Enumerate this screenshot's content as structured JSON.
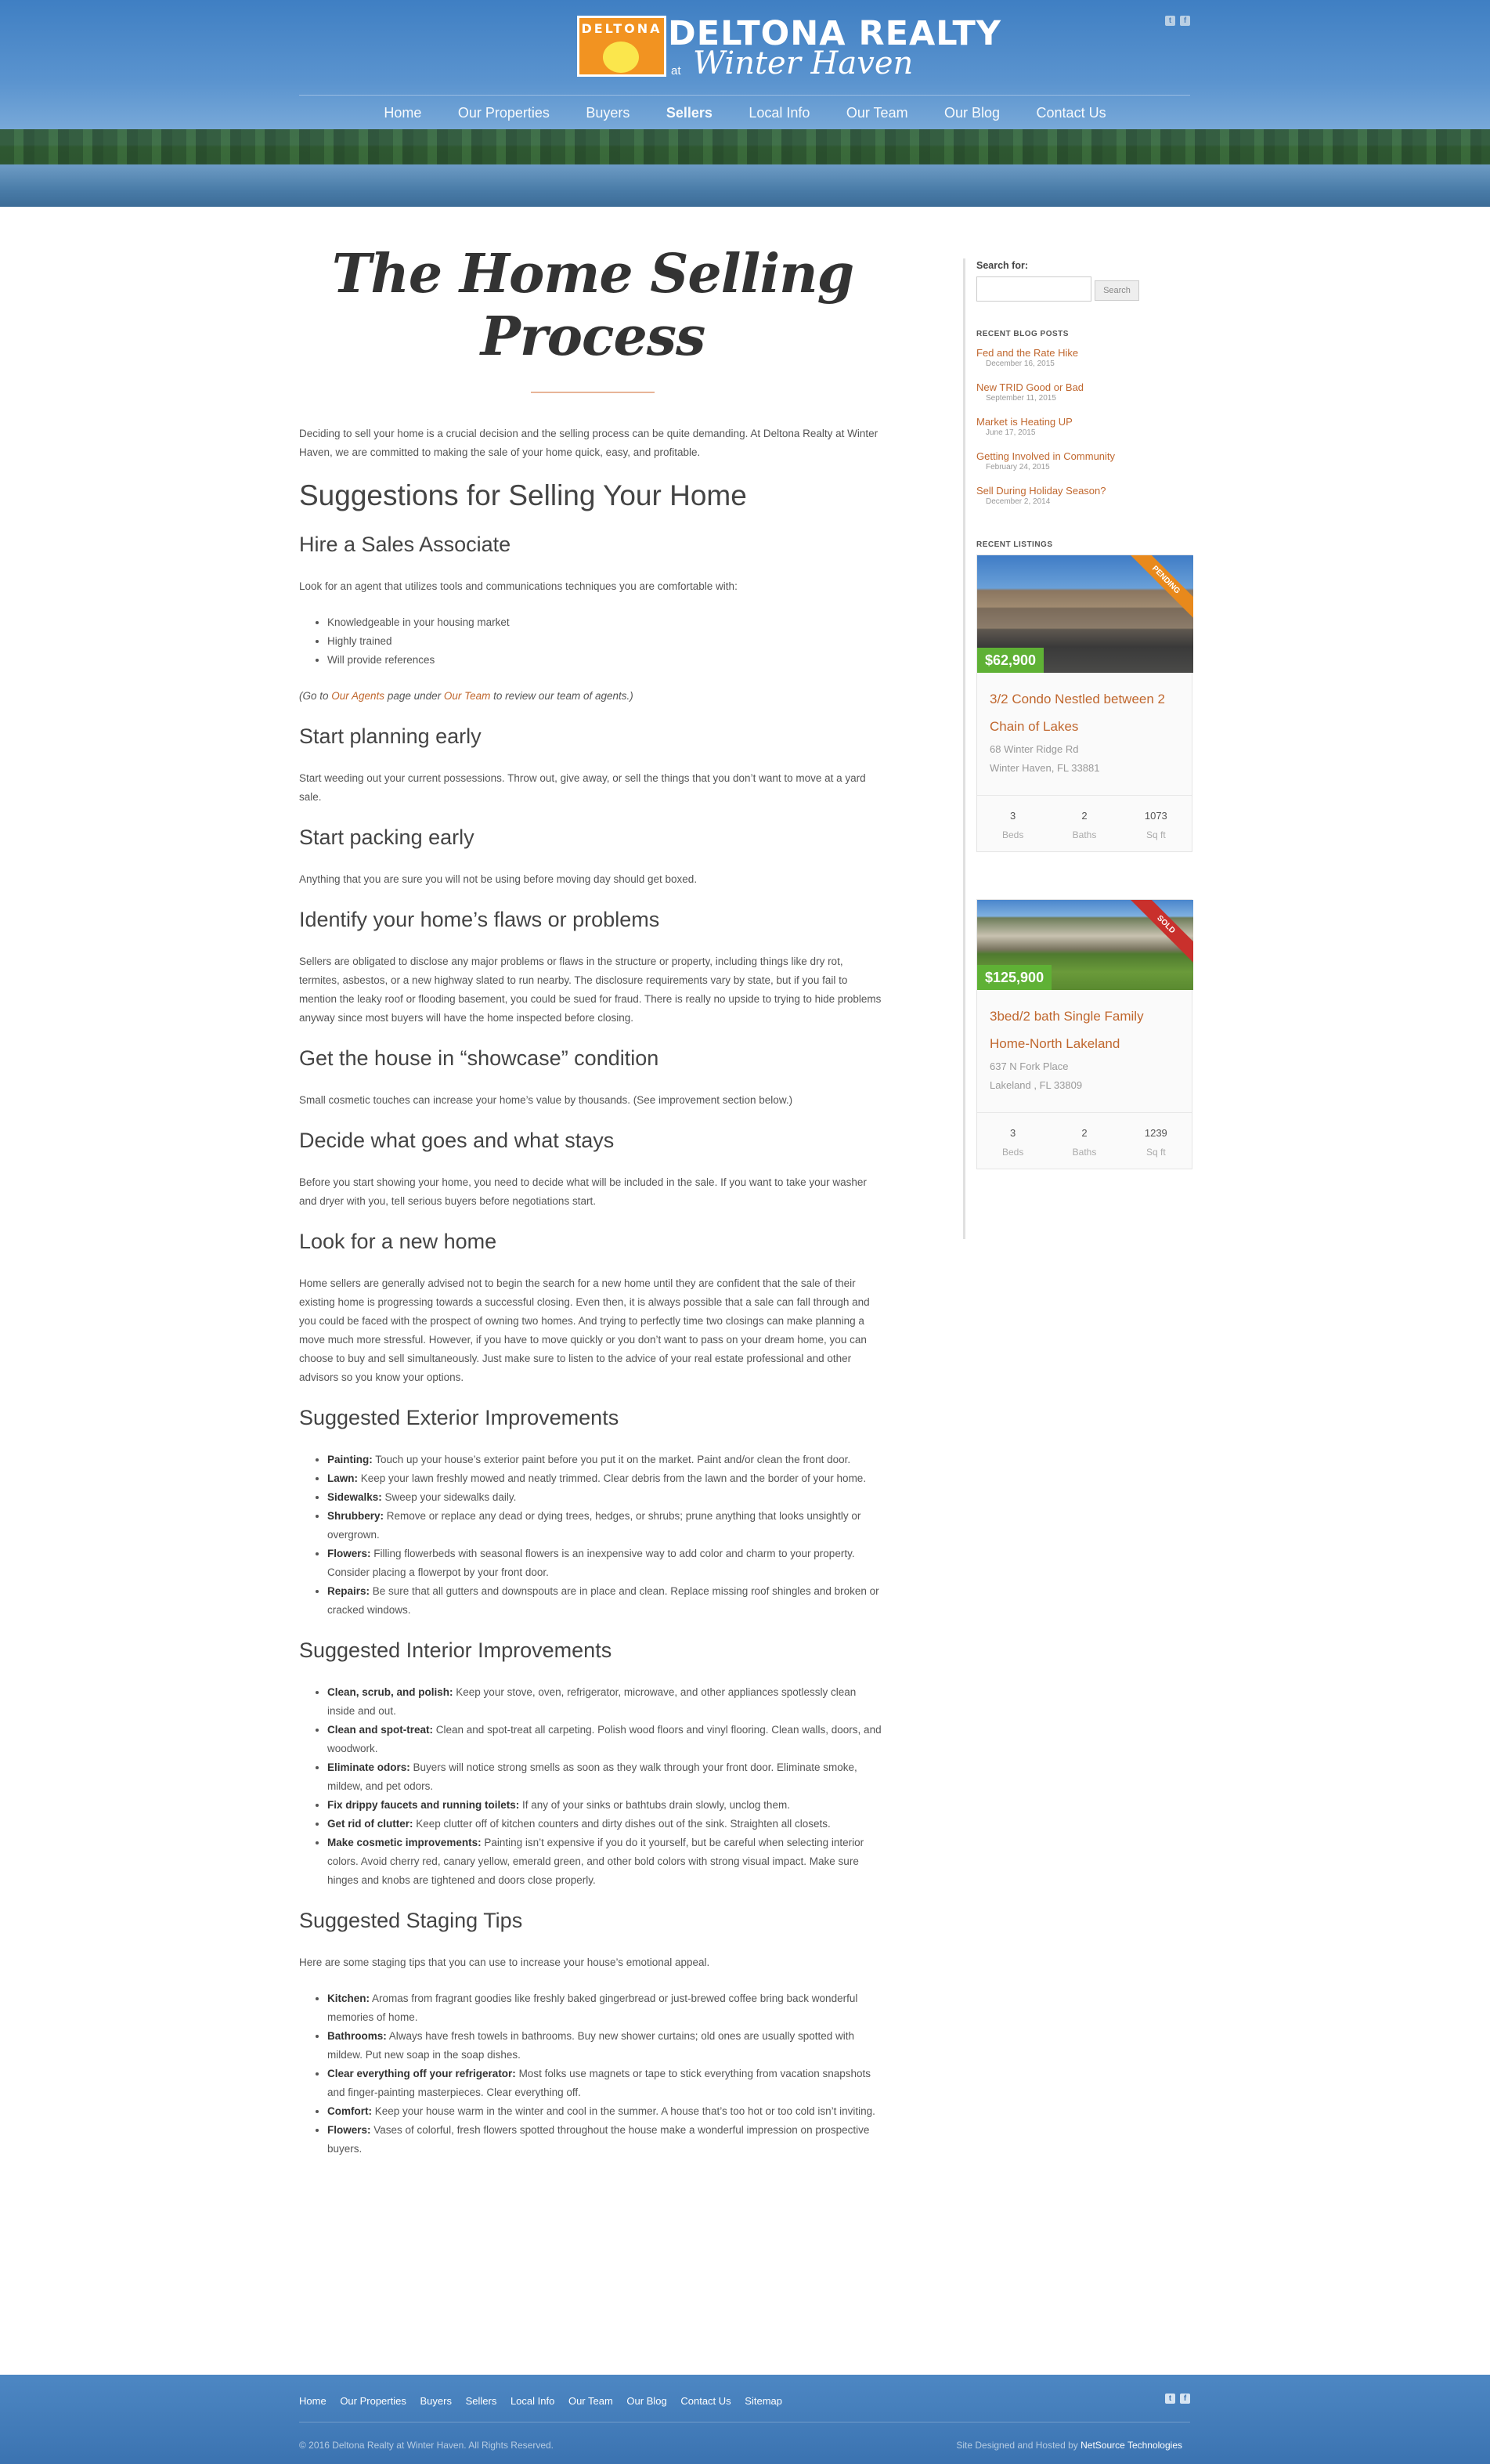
{
  "header": {
    "logo_mark": "DELTONA",
    "logo_name": "DELTONA REALTY",
    "logo_at": "at",
    "logo_sub": "Winter Haven",
    "nav": [
      "Home",
      "Our Properties",
      "Buyers",
      "Sellers",
      "Local Info",
      "Our Team",
      "Our Blog",
      "Contact Us"
    ],
    "active_nav": "Sellers",
    "social": [
      "twitter-icon",
      "facebook-icon"
    ]
  },
  "main": {
    "title": "The Home Selling Process",
    "intro": "Deciding to sell your home is a crucial decision and the selling process can be quite demanding. At Deltona Realty at Winter Haven, we are committed to making the sale of your home quick, easy, and profitable.",
    "h2_suggestions": "Suggestions for Selling Your Home",
    "h3_hire": "Hire a Sales Associate",
    "p_hire": "Look for an agent that utilizes tools and communications techniques you are comfortable with:",
    "hire_list": [
      "Knowledgeable in your housing market",
      "Highly trained",
      "Will provide references"
    ],
    "note": {
      "pre": "(Go to ",
      "link1": "Our Agents",
      "mid": " page under ",
      "link2": "Our Team",
      "post": " to review our team of agents.)"
    },
    "h3_planning": "Start planning early",
    "p_planning": "Start weeding out your current possessions. Throw out, give away, or sell the things that you don’t want to move at a yard sale.",
    "h3_packing": "Start packing early",
    "p_packing": "Anything that you are sure you will not be using before moving day should get boxed.",
    "h3_flaws": "Identify your home’s flaws or problems",
    "p_flaws": "Sellers are obligated to disclose any major problems or flaws in the structure or property, including things like dry rot, termites, asbestos, or a new highway slated to run nearby. The disclosure requirements vary by state, but if you fail to mention the leaky roof or flooding basement, you could be sued for fraud. There is really no upside to trying to hide problems anyway since most buyers will have the home inspected before closing.",
    "h3_showcase": "Get the house in “showcase” condition",
    "p_showcase": "Small cosmetic touches can increase your home’s value by thousands. (See improvement section below.)",
    "h3_stays": "Decide what goes and what stays",
    "p_stays": "Before you start showing your home, you need to decide what will be included in the sale. If you want to take your washer and dryer with you, tell serious buyers before negotiations start.",
    "h3_newhome": "Look for a new home",
    "p_newhome": "Home sellers are generally advised not to begin the search for a new home until they are confident that the sale of their existing home is progressing towards a successful closing. Even then, it is always possible that a sale can fall through and you could be faced with the prospect of owning two homes. And trying to perfectly time two closings can make planning a move much more stressful. However, if you have to move quickly or you don’t want to pass on your dream home, you can choose to buy and sell simultaneously. Just make sure to listen to the advice of your real estate professional and other advisors so you know your options.",
    "h3_exterior": "Suggested Exterior Improvements",
    "exterior": [
      {
        "b": "Painting:",
        "t": " Touch up your house’s exterior paint before you put it on the market. Paint and/or clean the front door."
      },
      {
        "b": "Lawn:",
        "t": " Keep your lawn freshly mowed and neatly trimmed. Clear debris from the lawn and the border of your home."
      },
      {
        "b": "Sidewalks:",
        "t": " Sweep your sidewalks daily."
      },
      {
        "b": "Shrubbery:",
        "t": " Remove or replace any dead or dying trees, hedges, or shrubs; prune anything that looks unsightly or overgrown."
      },
      {
        "b": "Flowers:",
        "t": " Filling flowerbeds with seasonal flowers is an inexpensive way to add color and charm to your property. Consider placing a flowerpot by your front door."
      },
      {
        "b": "Repairs:",
        "t": " Be sure that all gutters and downspouts are in place and clean. Replace missing roof shingles and broken or cracked windows."
      }
    ],
    "h3_interior": "Suggested Interior Improvements",
    "interior": [
      {
        "b": "Clean, scrub, and polish:",
        "t": " Keep your stove, oven, refrigerator, microwave, and other appliances spotlessly clean inside and out."
      },
      {
        "b": "Clean and spot-treat:",
        "t": " Clean and spot-treat all carpeting. Polish wood floors and vinyl flooring. Clean walls, doors, and woodwork."
      },
      {
        "b": "Eliminate odors:",
        "t": " Buyers will notice strong smells as soon as they walk through your front door. Eliminate smoke, mildew, and pet odors."
      },
      {
        "b": "Fix drippy faucets and running toilets:",
        "t": " If any of your sinks or bathtubs drain slowly, unclog them."
      },
      {
        "b": "Get rid of clutter:",
        "t": " Keep clutter off of kitchen counters and dirty dishes out of the sink. Straighten all closets."
      },
      {
        "b": "Make cosmetic improvements:",
        "t": " Painting isn’t expensive if you do it yourself, but be careful when selecting interior colors. Avoid cherry red, canary yellow, emerald green, and other bold colors with strong visual impact. Make sure hinges and knobs are tightened and doors close properly."
      }
    ],
    "h3_staging": "Suggested Staging Tips",
    "p_staging": "Here are some staging tips that you can use to increase your house’s emotional appeal.",
    "staging": [
      {
        "b": "Kitchen:",
        "t": " Aromas from fragrant goodies like freshly baked gingerbread or just-brewed coffee bring back wonderful memories of home."
      },
      {
        "b": "Bathrooms:",
        "t": " Always have fresh towels in bathrooms. Buy new shower curtains; old ones are usually spotted with mildew. Put new soap in the soap dishes."
      },
      {
        "b": "Clear everything off your refrigerator:",
        "t": " Most folks use magnets or tape to stick everything from vacation snapshots and finger-painting masterpieces. Clear everything off."
      },
      {
        "b": "Comfort:",
        "t": " Keep your house warm in the winter and cool in the summer. A house that’s too hot or too cold isn’t inviting."
      },
      {
        "b": "Flowers:",
        "t": " Vases of colorful, fresh flowers spotted throughout the house make a wonderful impression on prospective buyers."
      }
    ]
  },
  "sidebar": {
    "search_label": "Search for:",
    "search_value": "",
    "search_button": "Search",
    "blog_heading": "RECENT BLOG POSTS",
    "posts": [
      {
        "title": "Fed and the Rate Hike",
        "date": "December 16, 2015"
      },
      {
        "title": "New TRID Good or Bad",
        "date": "September 11, 2015"
      },
      {
        "title": "Market is Heating UP",
        "date": "June 17, 2015"
      },
      {
        "title": "Getting Involved in Community",
        "date": "February 24, 2015"
      },
      {
        "title": "Sell During Holiday Season?",
        "date": "December 2, 2014"
      }
    ],
    "listings_heading": "RECENT LISTINGS",
    "listings": [
      {
        "price": "$62,900",
        "ribbon": "PENDING",
        "title": "3/2 Condo Nestled between 2 Chain of Lakes",
        "street": "68 Winter Ridge Rd",
        "city": "Winter Haven, FL 33881",
        "beds": "3",
        "baths": "2",
        "sqft": "1073"
      },
      {
        "price": "$125,900",
        "ribbon": "SOLD",
        "title": "3bed/2 bath Single Family Home-North Lakeland",
        "street": "637 N Fork Place",
        "city": "Lakeland , FL 33809",
        "beds": "3",
        "baths": "2",
        "sqft": "1239"
      }
    ],
    "stat_labels": {
      "beds": "Beds",
      "baths": "Baths",
      "sqft": "Sq ft"
    }
  },
  "footer": {
    "nav": [
      "Home",
      "Our Properties",
      "Buyers",
      "Sellers",
      "Local Info",
      "Our Team",
      "Our Blog",
      "Contact Us",
      "Sitemap"
    ],
    "copyright": "© 2016 Deltona Realty at Winter Haven. All Rights Reserved.",
    "credits_pre": "Site Designed and Hosted by ",
    "credits_name": "NetSource Technologies"
  },
  "colors": {
    "accent": "#c0672e",
    "header_blue": "#4d87c3",
    "logo_orange": "#f29321",
    "price_green": "#5fb135",
    "pending": "#e8891c",
    "sold": "#c9302c"
  }
}
